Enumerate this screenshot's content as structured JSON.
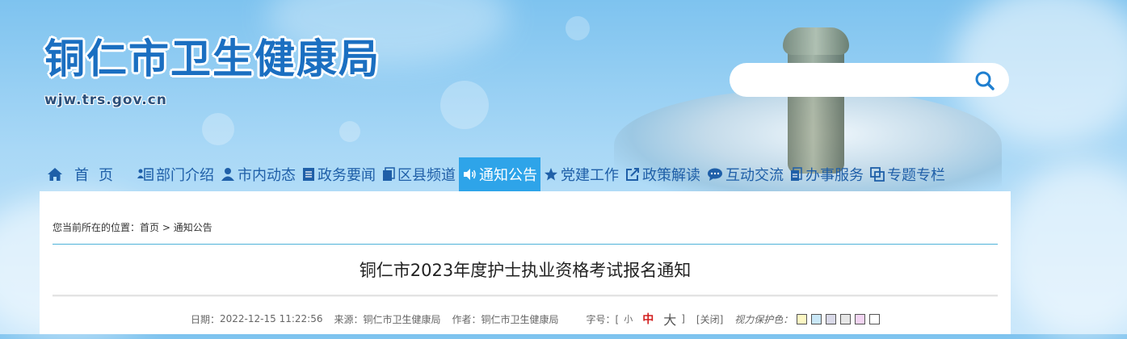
{
  "header": {
    "site_title": "铜仁市卫生健康局",
    "site_domain": "wjw.trs.gov.cn",
    "search": {
      "placeholder": "",
      "value": ""
    }
  },
  "nav": {
    "items": [
      {
        "label": "首页",
        "icon": "home-icon"
      },
      {
        "label": "部门介绍",
        "icon": "org-list-icon"
      },
      {
        "label": "市内动态",
        "icon": "person-icon"
      },
      {
        "label": "政务要闻",
        "icon": "document-icon"
      },
      {
        "label": "区县频道",
        "icon": "copy-icon"
      },
      {
        "label": "通知公告",
        "icon": "speaker-icon",
        "active": true
      },
      {
        "label": "党建工作",
        "icon": "star-icon"
      },
      {
        "label": "政策解读",
        "icon": "external-edit-icon"
      },
      {
        "label": "互动交流",
        "icon": "chat-icon"
      },
      {
        "label": "办事服务",
        "icon": "mobile-doc-icon"
      },
      {
        "label": "专题专栏",
        "icon": "window-icon"
      }
    ],
    "active_color": "#2ea4e9",
    "text_color": "#1f5fa8"
  },
  "breadcrumb": {
    "prefix": "您当前所在的位置：",
    "home": "首页",
    "separator": " > ",
    "current": "通知公告"
  },
  "article": {
    "title": "铜仁市2023年度护士执业资格考试报名通知",
    "date_label": "日期：",
    "date": "2022-12-15 11:22:56",
    "source_label": "来源：",
    "source": "铜仁市卫生健康局",
    "author_label": "作者：",
    "author": "铜仁市卫生健康局",
    "font_size_label": "字号：[",
    "size_small": "小",
    "size_mid": "中",
    "size_big": "大",
    "font_size_close": "]",
    "close_label": "[关闭]",
    "eye_care_label": "视力保护色：",
    "eye_care_colors": [
      "#fdf7c3",
      "#c9e7f7",
      "#d9d9e8",
      "#e6e6e6",
      "#f2d4f2",
      "#ffffff"
    ]
  }
}
